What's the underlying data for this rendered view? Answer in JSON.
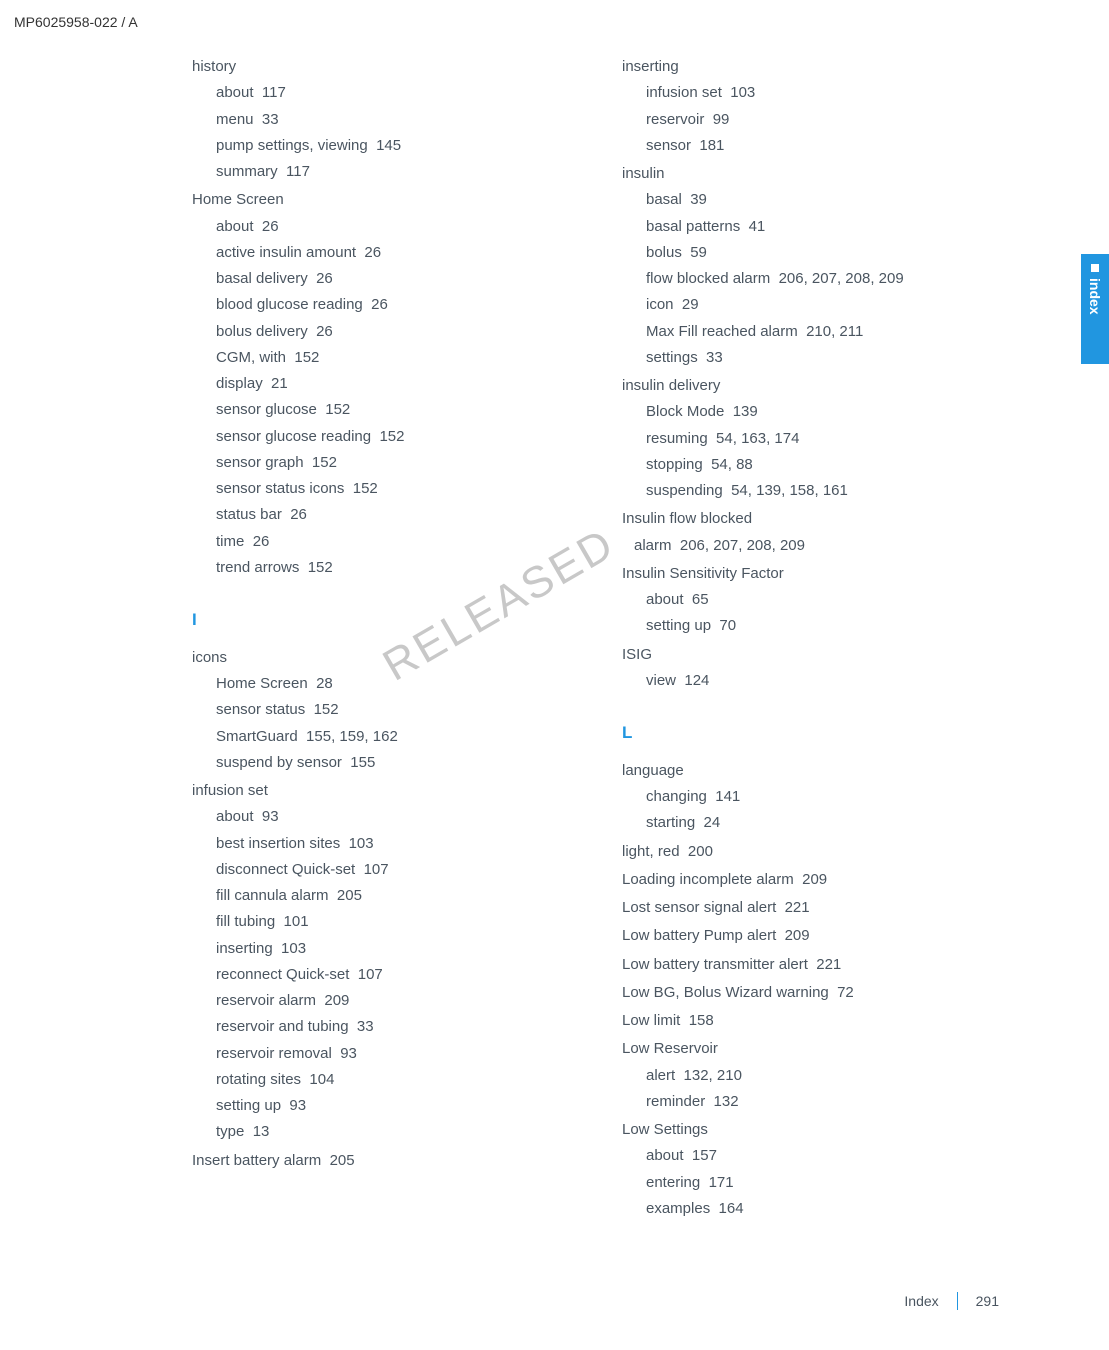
{
  "header_code": "MP6025958-022 / A",
  "watermark": "RELEASED",
  "side_tab": "index",
  "footer_label": "Index",
  "footer_page": "291",
  "col1": {
    "history": {
      "label": "history",
      "items": [
        {
          "t": "about",
          "p": "117"
        },
        {
          "t": "menu",
          "p": "33"
        },
        {
          "t": "pump settings, viewing",
          "p": "145"
        },
        {
          "t": "summary",
          "p": "117"
        }
      ]
    },
    "homescreen": {
      "label": "Home Screen",
      "items": [
        {
          "t": "about",
          "p": "26"
        },
        {
          "t": "active insulin amount",
          "p": "26"
        },
        {
          "t": "basal delivery",
          "p": "26"
        },
        {
          "t": "blood glucose reading",
          "p": "26"
        },
        {
          "t": "bolus delivery",
          "p": "26"
        },
        {
          "t": "CGM, with",
          "p": "152"
        },
        {
          "t": "display",
          "p": "21"
        },
        {
          "t": "sensor glucose",
          "p": "152"
        },
        {
          "t": "sensor glucose reading",
          "p": "152"
        },
        {
          "t": "sensor graph",
          "p": "152"
        },
        {
          "t": "sensor status icons",
          "p": "152"
        },
        {
          "t": "status bar",
          "p": "26"
        },
        {
          "t": "time",
          "p": "26"
        },
        {
          "t": "trend arrows",
          "p": "152"
        }
      ]
    },
    "letter_i": "I",
    "icons": {
      "label": "icons",
      "items": [
        {
          "t": "Home Screen",
          "p": "28"
        },
        {
          "t": "sensor status",
          "p": "152"
        },
        {
          "t": "SmartGuard",
          "p": "155, 159, 162"
        },
        {
          "t": "suspend by sensor",
          "p": "155"
        }
      ]
    },
    "infusionset": {
      "label": "infusion set",
      "items": [
        {
          "t": "about",
          "p": "93"
        },
        {
          "t": "best insertion sites",
          "p": "103"
        },
        {
          "t": "disconnect Quick-set",
          "p": "107"
        },
        {
          "t": "fill cannula alarm",
          "p": "205"
        },
        {
          "t": "fill tubing",
          "p": "101"
        },
        {
          "t": "inserting",
          "p": "103"
        },
        {
          "t": "reconnect Quick-set",
          "p": "107"
        },
        {
          "t": "reservoir alarm",
          "p": "209"
        },
        {
          "t": "reservoir and tubing",
          "p": "33"
        },
        {
          "t": "reservoir removal",
          "p": "93"
        },
        {
          "t": "rotating sites",
          "p": "104"
        },
        {
          "t": "setting up",
          "p": "93"
        },
        {
          "t": "type",
          "p": "13"
        }
      ]
    },
    "insertbattery": {
      "t": "Insert battery alarm",
      "p": "205"
    }
  },
  "col2": {
    "inserting": {
      "label": "inserting",
      "items": [
        {
          "t": "infusion set",
          "p": "103"
        },
        {
          "t": "reservoir",
          "p": "99"
        },
        {
          "t": "sensor",
          "p": "181"
        }
      ]
    },
    "insulin": {
      "label": "insulin",
      "items": [
        {
          "t": "basal",
          "p": "39"
        },
        {
          "t": "basal patterns",
          "p": "41"
        },
        {
          "t": "bolus",
          "p": "59"
        },
        {
          "t": "flow blocked alarm",
          "p": "206, 207, 208, 209"
        },
        {
          "t": "icon",
          "p": "29"
        },
        {
          "t": "Max Fill reached alarm",
          "p": "210, 211"
        },
        {
          "t": "settings",
          "p": "33"
        }
      ]
    },
    "insulindelivery": {
      "label": "insulin delivery",
      "items": [
        {
          "t": "Block Mode",
          "p": "139"
        },
        {
          "t": "resuming",
          "p": "54, 163, 174"
        },
        {
          "t": "stopping",
          "p": "54, 88"
        },
        {
          "t": "suspending",
          "p": "54, 139, 158, 161"
        }
      ]
    },
    "insulinflow": {
      "label": "Insulin flow blocked",
      "sub": {
        "t": "alarm",
        "p": "206, 207, 208, 209"
      }
    },
    "isf": {
      "label": "Insulin Sensitivity Factor",
      "items": [
        {
          "t": "about",
          "p": "65"
        },
        {
          "t": "setting up",
          "p": "70"
        }
      ]
    },
    "isig": {
      "label": "ISIG",
      "items": [
        {
          "t": "view",
          "p": "124"
        }
      ]
    },
    "letter_l": "L",
    "language": {
      "label": "language",
      "items": [
        {
          "t": "changing",
          "p": "141"
        },
        {
          "t": "starting",
          "p": "24"
        }
      ]
    },
    "simples": [
      {
        "t": "light, red",
        "p": "200"
      },
      {
        "t": "Loading incomplete alarm",
        "p": "209"
      },
      {
        "t": "Lost sensor signal alert",
        "p": "221"
      },
      {
        "t": "Low battery Pump alert",
        "p": "209"
      },
      {
        "t": "Low battery transmitter alert",
        "p": "221"
      },
      {
        "t": "Low BG, Bolus Wizard warning",
        "p": "72"
      },
      {
        "t": "Low limit",
        "p": "158"
      }
    ],
    "lowreservoir": {
      "label": "Low Reservoir",
      "items": [
        {
          "t": "alert",
          "p": "132, 210"
        },
        {
          "t": "reminder",
          "p": "132"
        }
      ]
    },
    "lowsettings": {
      "label": "Low Settings",
      "items": [
        {
          "t": "about",
          "p": "157"
        },
        {
          "t": "entering",
          "p": "171"
        },
        {
          "t": "examples",
          "p": "164"
        }
      ]
    }
  }
}
